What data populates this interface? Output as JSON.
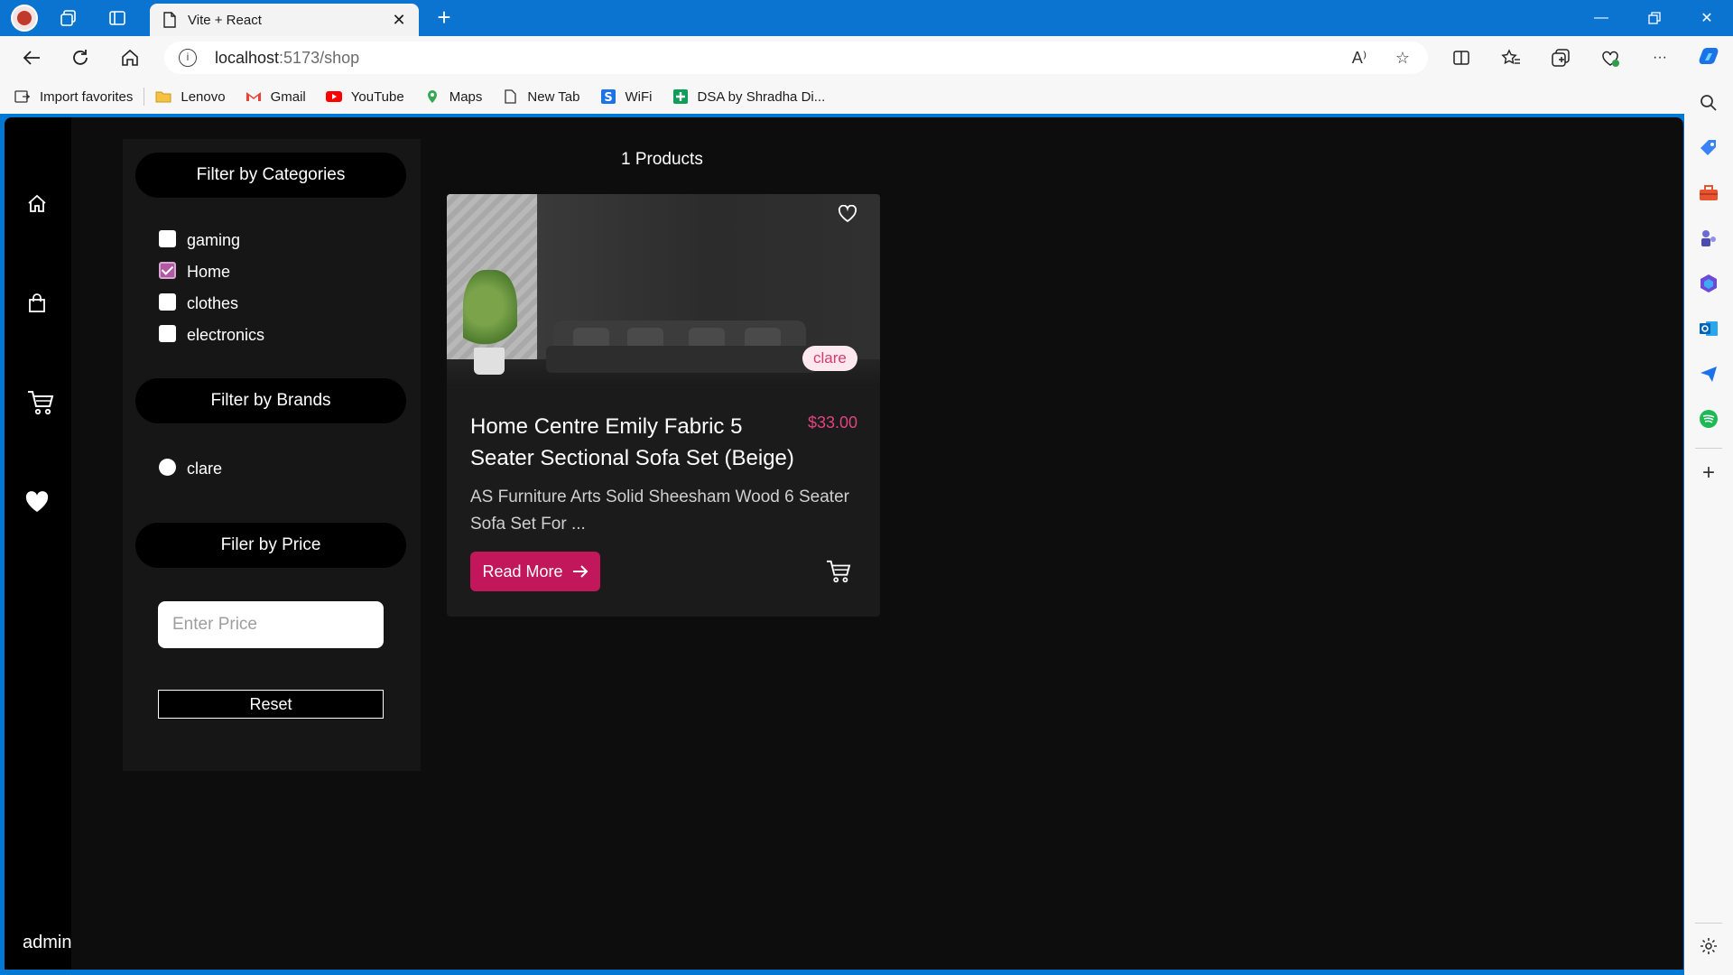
{
  "browser": {
    "tab_title": "Vite + React",
    "url_host": "localhost",
    "url_path": ":5173/shop",
    "favorites": [
      {
        "label": "Import favorites",
        "icon": "import-icon"
      },
      {
        "label": "Lenovo",
        "icon": "folder-icon"
      },
      {
        "label": "Gmail",
        "icon": "gmail-icon"
      },
      {
        "label": "YouTube",
        "icon": "youtube-icon"
      },
      {
        "label": "Maps",
        "icon": "maps-icon"
      },
      {
        "label": "New Tab",
        "icon": "page-icon"
      },
      {
        "label": "WiFi",
        "icon": "s-icon"
      },
      {
        "label": "DSA by Shradha Di...",
        "icon": "plus-sheet-icon"
      }
    ],
    "colors": {
      "accent": "#0a74d0"
    }
  },
  "app": {
    "user_label": "admin",
    "filters": {
      "categories_heading": "Filter by Categories",
      "categories": [
        {
          "label": "gaming",
          "checked": false
        },
        {
          "label": "Home",
          "checked": true
        },
        {
          "label": "clothes",
          "checked": false
        },
        {
          "label": "electronics",
          "checked": false
        }
      ],
      "brands_heading": "Filter by Brands",
      "brands": [
        {
          "label": "clare",
          "selected": false
        }
      ],
      "price_heading": "Filer by Price",
      "price_placeholder": "Enter Price",
      "reset_label": "Reset"
    },
    "product_count": "1 Products",
    "products": [
      {
        "title": "Home Centre Emily Fabric 5 Seater Sectional Sofa Set (Beige)",
        "price": "$33.00",
        "brand": "clare",
        "description": "AS Furniture Arts Solid Sheesham Wood 6 Seater Sofa Set For ...",
        "cta": "Read More"
      }
    ],
    "colors": {
      "primary": "#c2185b",
      "price": "#e0447e",
      "background": "#0d0d0d"
    }
  }
}
